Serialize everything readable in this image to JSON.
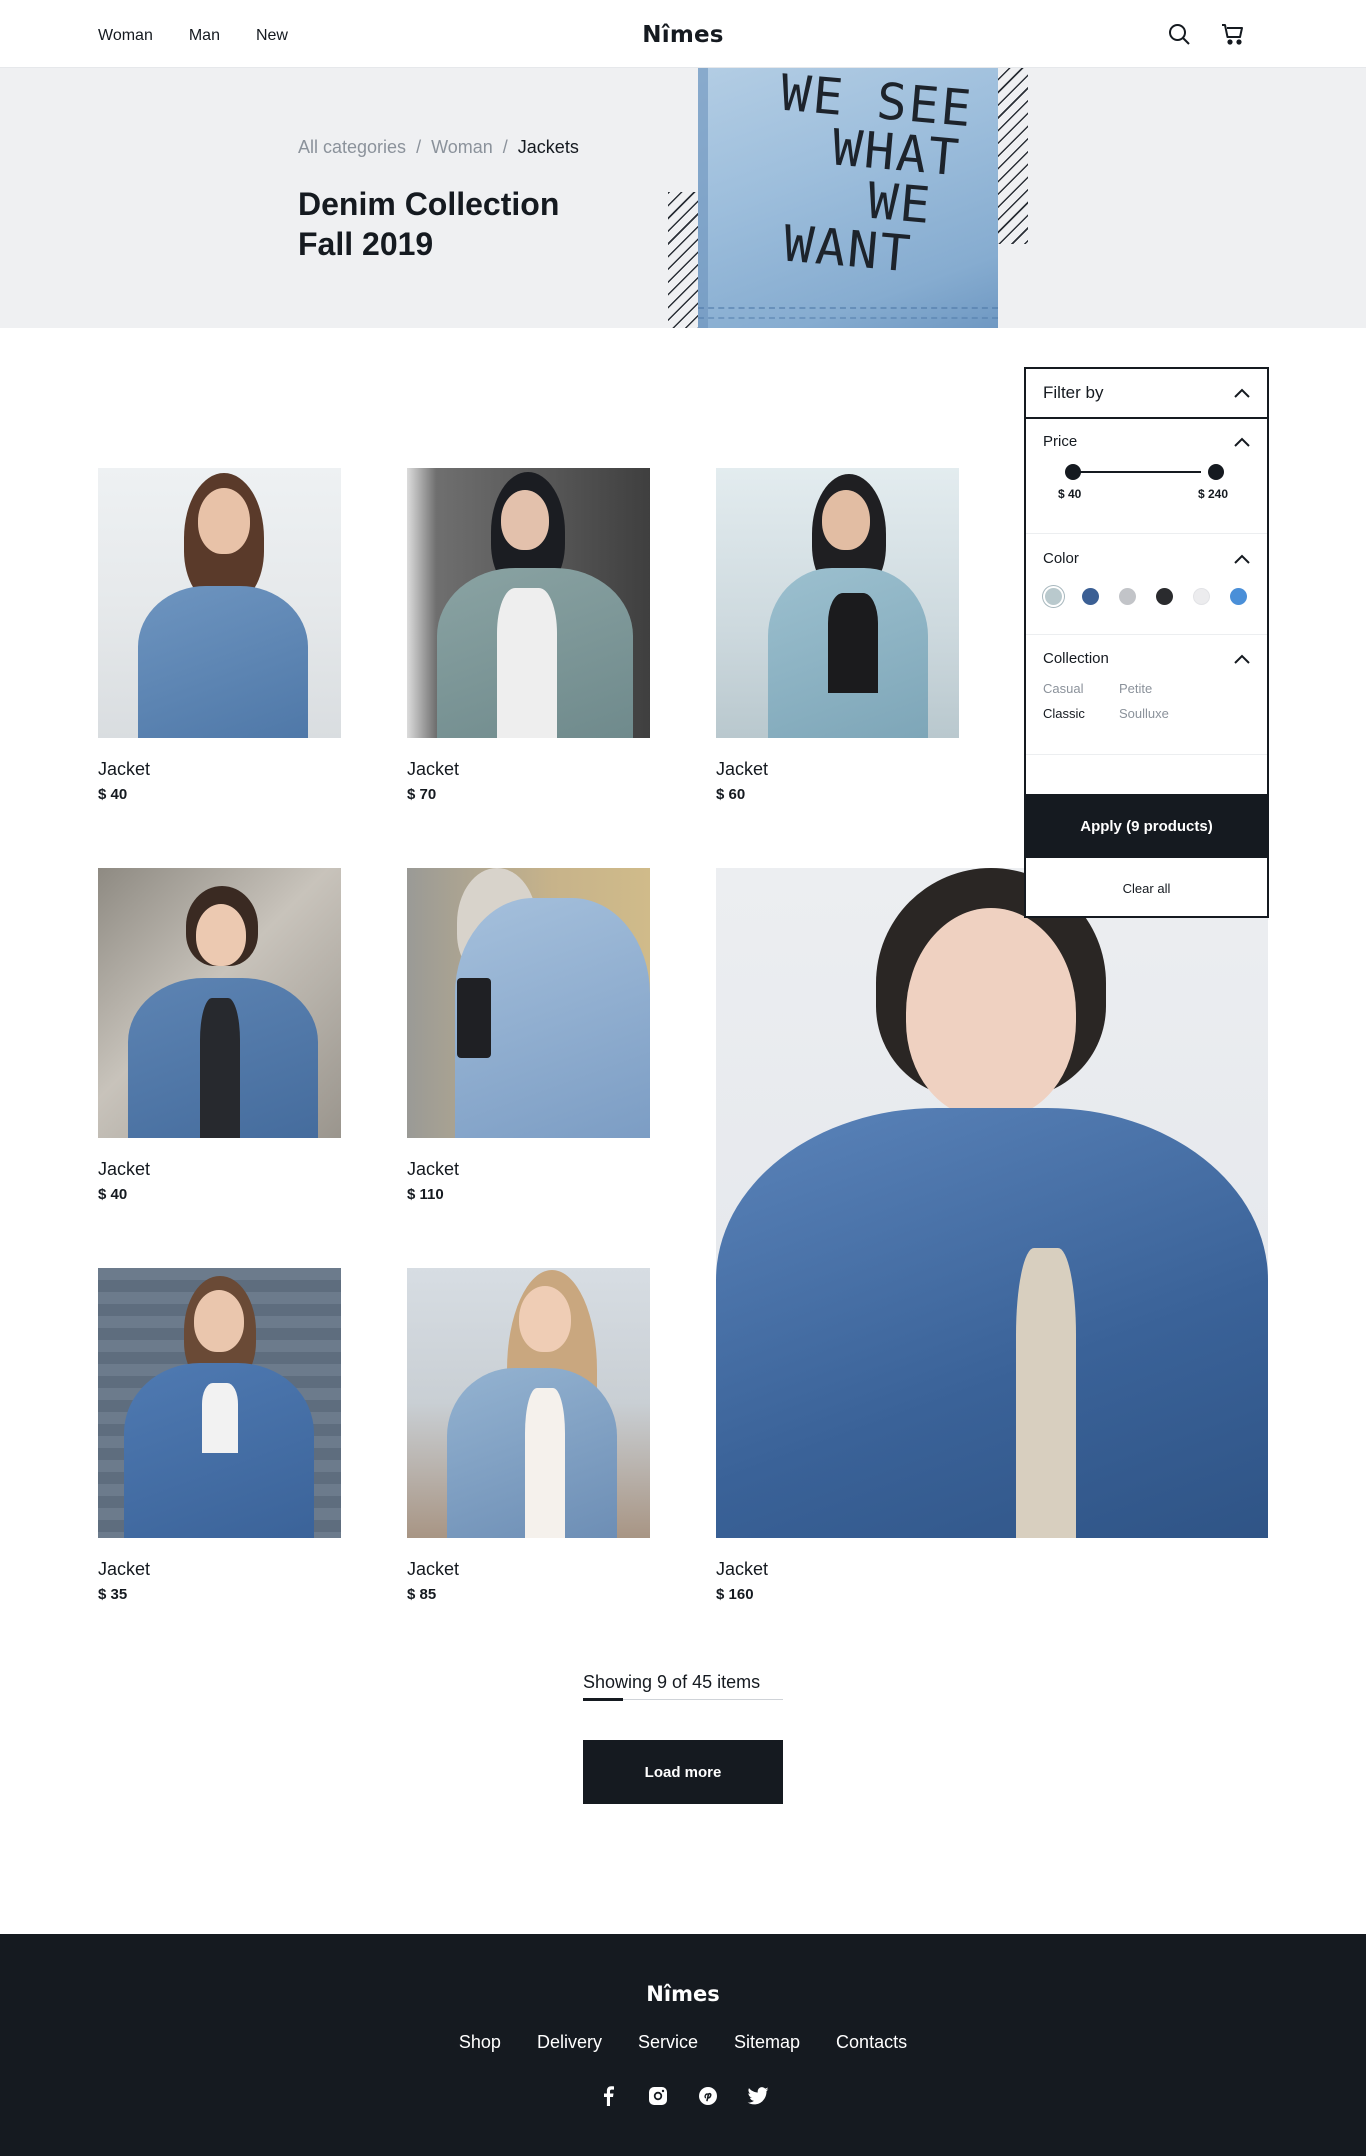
{
  "header": {
    "nav": [
      "Woman",
      "Man",
      "New"
    ],
    "logo": "Nîmes",
    "icons": [
      "search-icon",
      "cart-icon"
    ]
  },
  "hero": {
    "breadcrumb": [
      "All categories",
      "Woman",
      "Jackets"
    ],
    "separator": "/",
    "title_line1": "Denim Collection",
    "title_line2": "Fall 2019",
    "image_text": [
      "WE SEE",
      "WHAT",
      "WE",
      "WANT"
    ]
  },
  "products": [
    {
      "name": "Jacket",
      "price": "$ 40"
    },
    {
      "name": "Jacket",
      "price": "$ 70"
    },
    {
      "name": "Jacket",
      "price": "$ 60"
    },
    {
      "name": "Jacket",
      "price": "$ 40"
    },
    {
      "name": "Jacket",
      "price": "$ 110"
    },
    {
      "name": "Jacket",
      "price": "$ 160"
    },
    {
      "name": "Jacket",
      "price": "$ 35"
    },
    {
      "name": "Jacket",
      "price": "$ 85"
    }
  ],
  "filter": {
    "title": "Filter by",
    "price": {
      "label": "Price",
      "min": "$ 40",
      "max": "$ 240"
    },
    "color": {
      "label": "Color",
      "swatches": [
        "#b9c9cd",
        "#3b5f94",
        "#c2c4c8",
        "#2a2b2e",
        "#ececee",
        "#4a8fd8"
      ],
      "selected": 0
    },
    "collection": {
      "label": "Collection",
      "options": [
        "Casual",
        "Petite",
        "Classic",
        "Soulluxe"
      ],
      "selected": "Classic"
    },
    "apply_label": "Apply (9 products)",
    "clear_label": "Clear all"
  },
  "pager": {
    "showing": "Showing 9 of 45 items",
    "shown": 9,
    "total": 45,
    "load_more": "Load more"
  },
  "footer": {
    "logo": "Nîmes",
    "links": [
      "Shop",
      "Delivery",
      "Service",
      "Sitemap",
      "Contacts"
    ],
    "social": [
      "facebook-icon",
      "instagram-icon",
      "pinterest-icon",
      "twitter-icon"
    ]
  }
}
